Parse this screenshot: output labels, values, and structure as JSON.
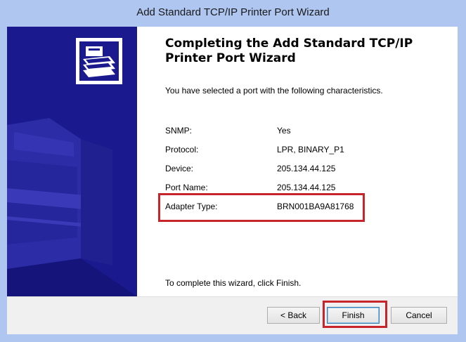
{
  "window": {
    "title": "Add Standard TCP/IP Printer Port Wizard"
  },
  "page": {
    "heading": "Completing the Add Standard TCP/IP Printer Port Wizard",
    "intro": "You have selected a port with the following characteristics.",
    "properties": [
      {
        "label": "SNMP:",
        "value": "Yes"
      },
      {
        "label": "Protocol:",
        "value": "LPR, BINARY_P1"
      },
      {
        "label": "Device:",
        "value": "205.134.44.125"
      },
      {
        "label": "Port Name:",
        "value": "205.134.44.125"
      },
      {
        "label": "Adapter Type:",
        "value": "BRN001BA9A81768"
      }
    ],
    "finish_note": "To complete this wizard, click Finish."
  },
  "buttons": {
    "back": "< Back",
    "finish": "Finish",
    "cancel": "Cancel"
  },
  "colors": {
    "sidebar": "#1a1a8e",
    "highlight": "#c8242b",
    "titlebar": "#aec6f0"
  },
  "icons": {
    "wizard_logo": "printer-wizard-icon"
  }
}
